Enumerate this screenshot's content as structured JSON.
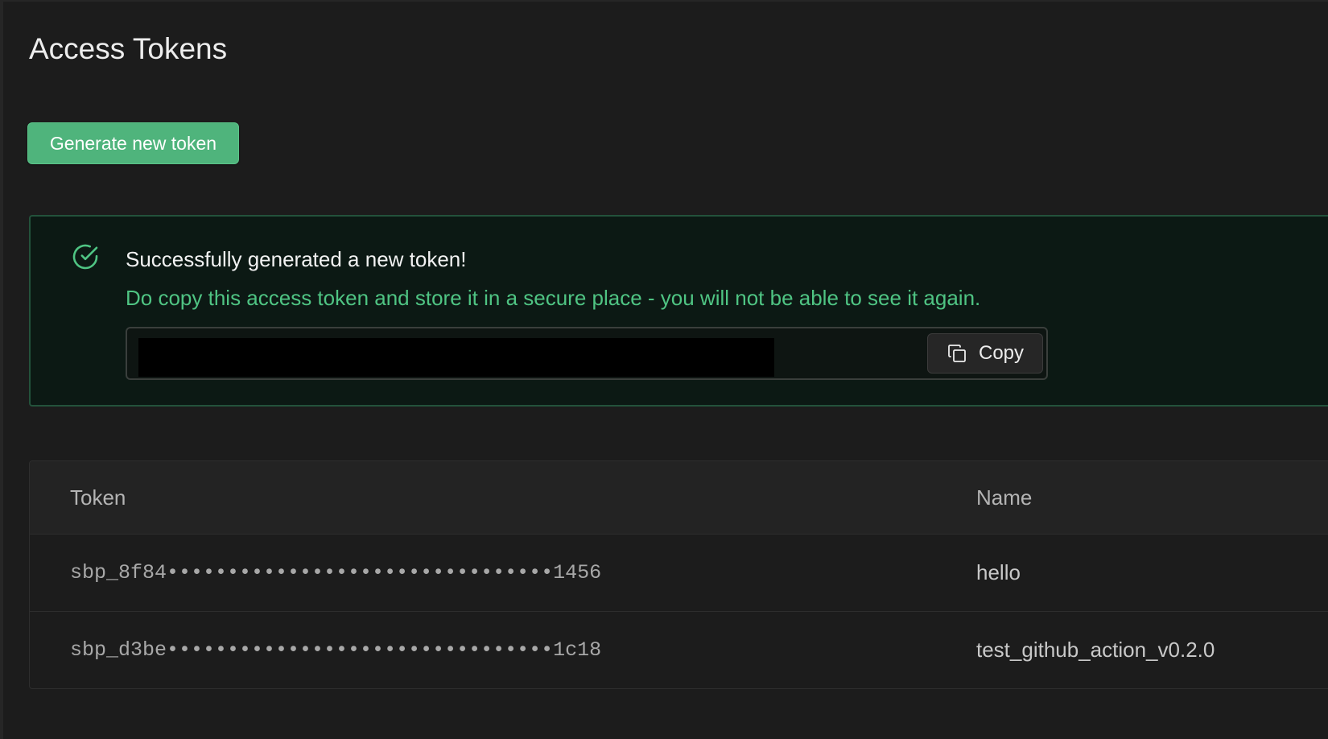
{
  "page": {
    "title": "Access Tokens"
  },
  "actions": {
    "generate_label": "Generate new token"
  },
  "alert": {
    "title": "Successfully generated a new token!",
    "description": "Do copy this access token and store it in a secure place - you will not be able to see it again.",
    "token_value": "",
    "copy_label": "Copy",
    "icon": "check-circle-icon",
    "accent_color": "#4fc483"
  },
  "table": {
    "headers": {
      "token": "Token",
      "name": "Name"
    },
    "rows": [
      {
        "token": "sbp_8f84••••••••••••••••••••••••••••••••1456",
        "name": "hello"
      },
      {
        "token": "sbp_d3be••••••••••••••••••••••••••••••••1c18",
        "name": "test_github_action_v0.2.0"
      }
    ]
  },
  "colors": {
    "background": "#1c1c1c",
    "brand_green": "#4fb47c",
    "alert_background": "#0c1914",
    "alert_border": "#23523b"
  }
}
